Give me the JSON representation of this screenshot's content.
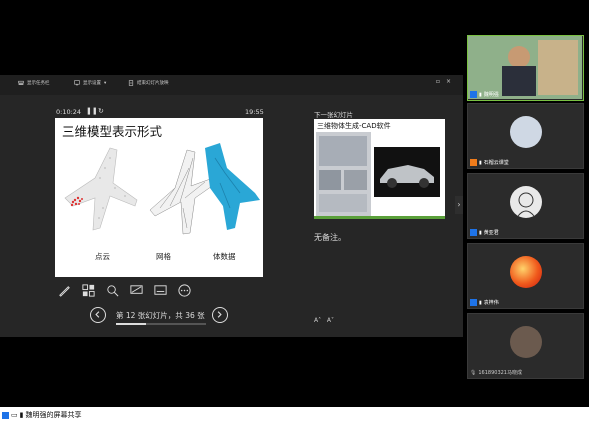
{
  "toolbar": {
    "show_taskbar": "显示任务栏",
    "display_settings": "显示设置",
    "end_show": "结束幻灯片放映"
  },
  "presenter": {
    "elapsed": "0:10:24",
    "clock": "19:55",
    "slide": {
      "title": "三维模型表示形式",
      "captions": [
        "点云",
        "网格",
        "体数据"
      ]
    },
    "slide_count": "第 12 张幻灯片，共 36 张",
    "progress": 0.33,
    "next_label": "下一张幻灯片",
    "next_slide_title": "三维物体生成-CAD软件",
    "notes": "无备注。"
  },
  "gallery": {
    "participants": [
      {
        "name": "魏明强",
        "badge": "blue"
      },
      {
        "name": "石榴云课堂",
        "badge": "orange"
      },
      {
        "name": "黄亚君",
        "badge": "blue"
      },
      {
        "name": "袁梓伟",
        "badge": "blue"
      },
      {
        "name": "161890321马晓成",
        "badge": "mic"
      }
    ]
  },
  "status": {
    "share": "魏明强的屏幕共享"
  }
}
